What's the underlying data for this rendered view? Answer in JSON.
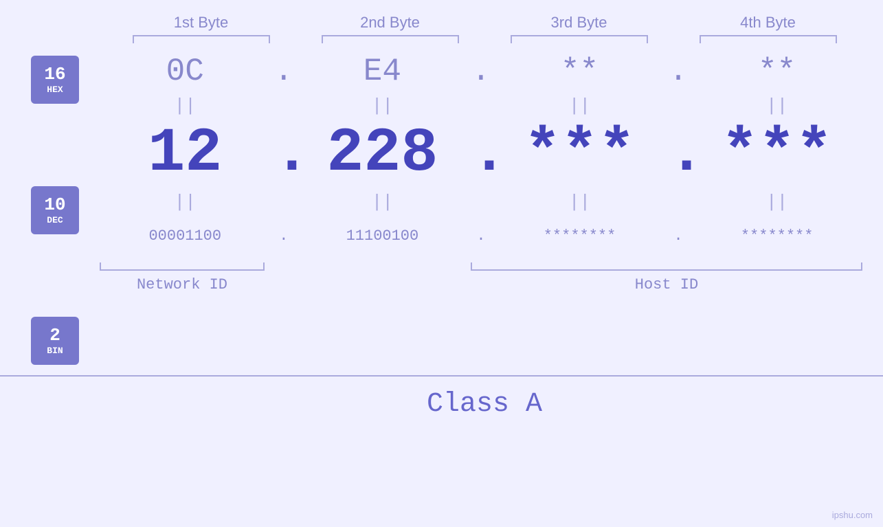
{
  "bytes": {
    "headers": [
      "1st Byte",
      "2nd Byte",
      "3rd Byte",
      "4th Byte"
    ]
  },
  "badges": [
    {
      "number": "16",
      "label": "HEX"
    },
    {
      "number": "10",
      "label": "DEC"
    },
    {
      "number": "2",
      "label": "BIN"
    }
  ],
  "hex_row": {
    "values": [
      "0C",
      "E4",
      "**",
      "**"
    ],
    "dots": [
      ".",
      ".",
      ".",
      ""
    ]
  },
  "dec_row": {
    "values": [
      "12",
      "228",
      "***",
      "***"
    ],
    "dots": [
      ".",
      ".",
      ".",
      ""
    ]
  },
  "bin_row": {
    "values": [
      "00001100",
      "11100100",
      "********",
      "********"
    ],
    "dots": [
      ".",
      ".",
      ".",
      ""
    ]
  },
  "labels": {
    "network_id": "Network ID",
    "host_id": "Host ID",
    "class": "Class A"
  },
  "watermark": "ipshu.com",
  "equals": "||"
}
